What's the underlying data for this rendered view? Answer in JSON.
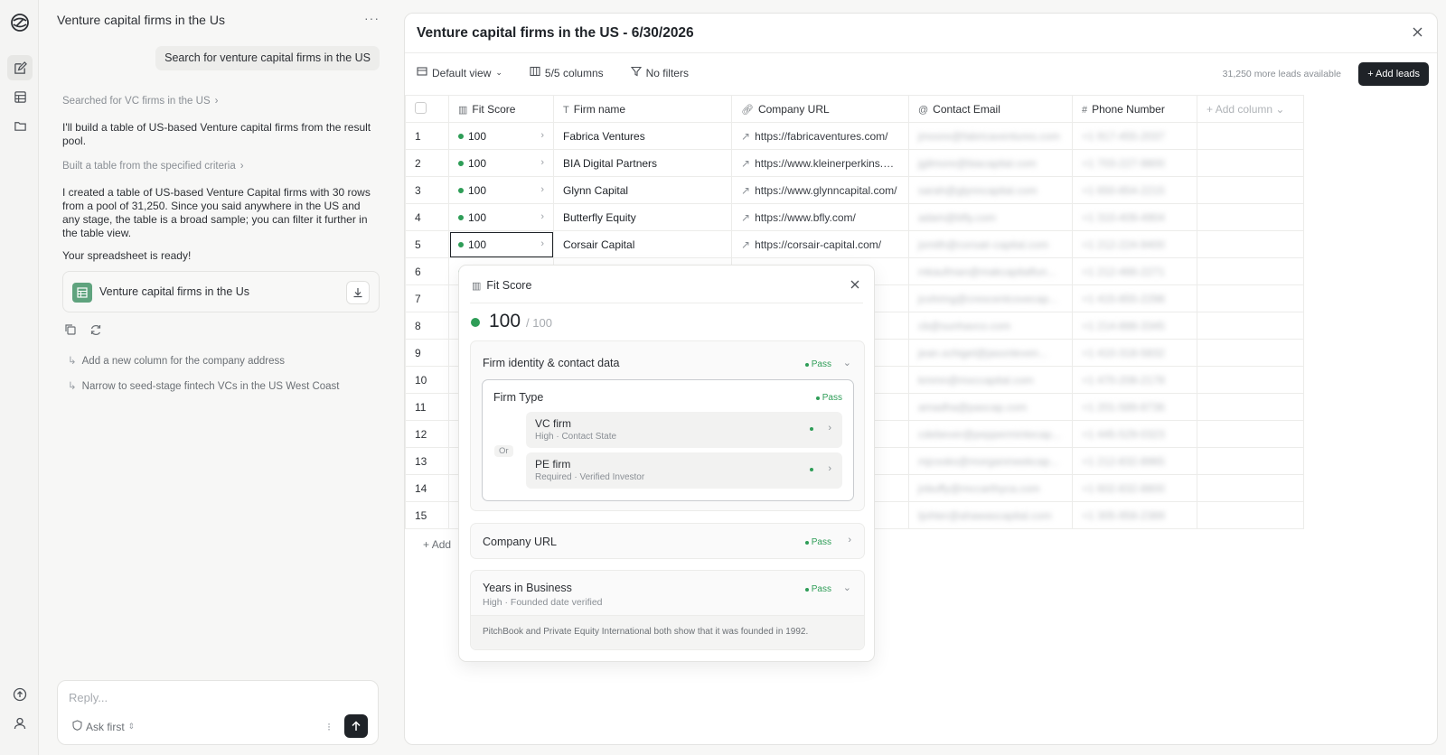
{
  "chat": {
    "title": "Venture capital firms in the Us",
    "menu": "···",
    "user_message": "Search for venture capital firms in the US",
    "step1": "Searched for VC firms in the US",
    "para1": "I'll build a table of US-based Venture capital firms from the result pool.",
    "step2": "Built a table from the specified criteria",
    "para2": "I created a table of US-based Venture Capital firms with 30 rows from a pool of 31,250. Since you said anywhere in the US and any stage, the table is a broad sample; you can filter it further in the table view.",
    "para3": "Your spreadsheet is ready!",
    "file_name": "Venture capital firms in the Us",
    "suggestions": [
      "Add a new column for the company address",
      "Narrow to seed-stage fintech VCs in the US West Coast"
    ],
    "reply_placeholder": "Reply...",
    "ask_first": "Ask first"
  },
  "main": {
    "title": "Venture capital firms in the US - 6/30/2026",
    "toolbar": {
      "view": "Default view",
      "columns": "5/5 columns",
      "filters": "No filters"
    },
    "more_leads": "31,250 more leads available",
    "add_leads": "+ Add leads",
    "columns": [
      "Fit Score",
      "Firm name",
      "Company URL",
      "Contact Email",
      "Phone Number",
      "Add column"
    ],
    "add_row": "Add",
    "rows": [
      {
        "n": "1",
        "fit": "100",
        "name": "Fabrica Ventures",
        "url": "https://fabricaventures.com/",
        "email": "jmoore@fabricaventures.com",
        "phone": "+1 917-455-2037"
      },
      {
        "n": "2",
        "fit": "100",
        "name": "BIA Digital Partners",
        "url": "https://www.kleinerperkins.com/",
        "email": "jgilmore@biacapital.com",
        "phone": "+1 703-227-9800"
      },
      {
        "n": "3",
        "fit": "100",
        "name": "Glynn Capital",
        "url": "https://www.glynncapital.com/",
        "email": "sarah@glynncapital.com",
        "phone": "+1 650-854-2215"
      },
      {
        "n": "4",
        "fit": "100",
        "name": "Butterfly Equity",
        "url": "https://www.bfly.com/",
        "email": "adam@bfly.com",
        "phone": "+1 310-409-4904"
      },
      {
        "n": "5",
        "fit": "100",
        "name": "Corsair Capital",
        "url": "https://corsair-capital.com/",
        "email": "jsmith@corsair-capital.com",
        "phone": "+1 212-224-9400"
      },
      {
        "n": "6",
        "fit": "100",
        "name": "",
        "url": "https://fun...",
        "email": "mkaufman@makcapitalfun...",
        "phone": "+1 212-466-2271"
      },
      {
        "n": "7",
        "fit": "100",
        "name": "",
        "url": "m/",
        "email": "jcohring@crescentcovecap...",
        "phone": "+1 415-855-2298"
      },
      {
        "n": "8",
        "fit": "100",
        "name": "",
        "url": "/",
        "email": "cb@sunhavco.com",
        "phone": "+1 214-888-3345"
      },
      {
        "n": "9",
        "fit": "100",
        "name": "",
        "url": ".co...",
        "email": "jean.schigel@jasonleven...",
        "phone": "+1 410-318-5832"
      },
      {
        "n": "10",
        "fit": "100",
        "name": "",
        "url": "m/",
        "email": "kmmn@mxccapital.com",
        "phone": "+1 470-208-2178"
      },
      {
        "n": "11",
        "fit": "100",
        "name": "",
        "url": "om/",
        "email": "amadha@pascap.com",
        "phone": "+1 201-589-8736"
      },
      {
        "n": "12",
        "fit": "100",
        "name": "",
        "url": "cap...",
        "email": "cdebever@peppermintecap...",
        "phone": "+1 445-529-0323"
      },
      {
        "n": "13",
        "fit": "100",
        "name": "",
        "url": "ekc...",
        "email": "mjcooks@morganmeekcap...",
        "phone": "+1 212-832-8965"
      },
      {
        "n": "14",
        "fit": "100",
        "name": "",
        "url": "al.c...",
        "email": "jnbuffy@mccarthyca.com",
        "phone": "+1 602-832-8800"
      },
      {
        "n": "15",
        "fit": "100",
        "name": "",
        "url": "n/",
        "email": "tjohter@ahawascapital.com",
        "phone": "+1 305-958-2389"
      }
    ]
  },
  "popover": {
    "title": "Fit Score",
    "score": "100",
    "max": "/ 100",
    "section1": {
      "title": "Firm identity & contact data",
      "status": "Pass",
      "inner_title": "Firm Type",
      "inner_status": "Pass",
      "or_label": "Or",
      "options": [
        {
          "title": "VC firm",
          "sub": "High · Contact State"
        },
        {
          "title": "PE firm",
          "sub": "Required · Verified Investor"
        }
      ]
    },
    "section2": {
      "title": "Company URL",
      "status": "Pass"
    },
    "section3": {
      "title": "Years in Business",
      "sub": "High · Founded date verified",
      "status": "Pass",
      "note": "PitchBook and Private Equity International both show that it was founded in 1992."
    }
  },
  "colors": {
    "accent_green": "#2e9d57",
    "dark": "#1f2328"
  }
}
